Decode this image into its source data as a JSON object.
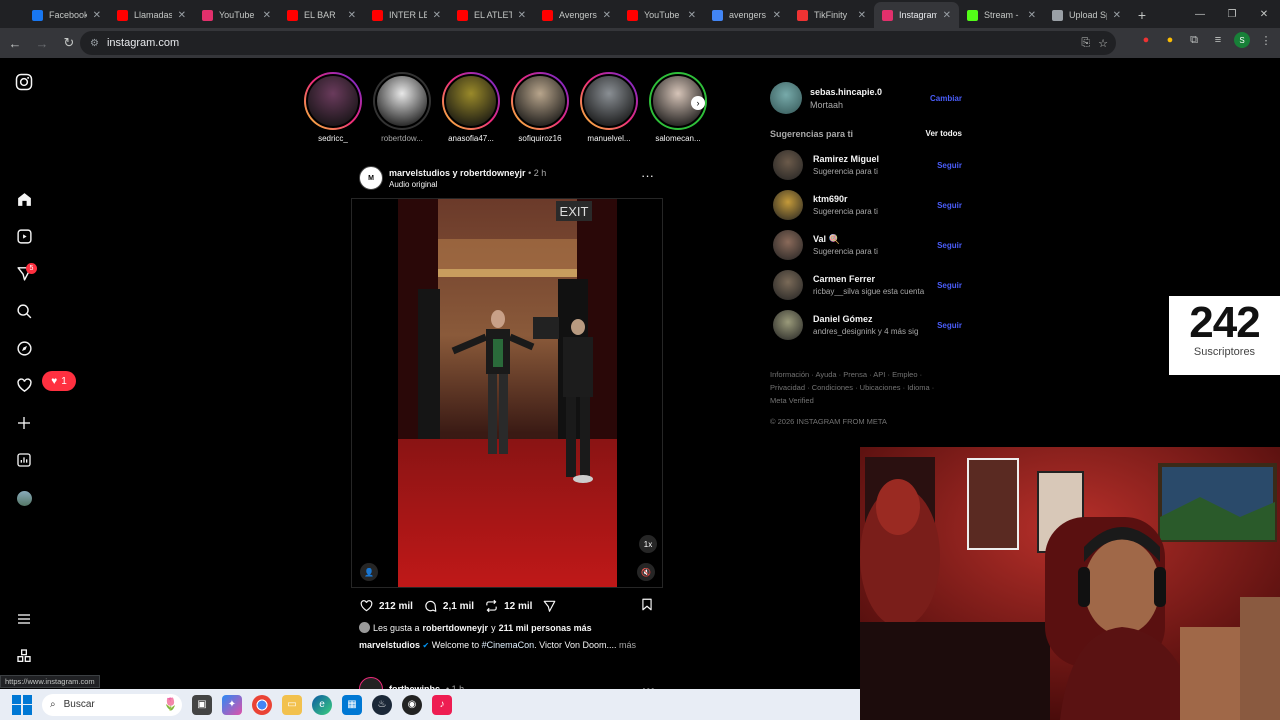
{
  "browser": {
    "tabs": [
      {
        "title": "Facebook",
        "favicon": "facebook-icon",
        "color": "#1877f2"
      },
      {
        "title": "Llamadas",
        "favicon": "youtube-icon",
        "color": "#ff0000"
      },
      {
        "title": "YouTube I",
        "favicon": "instagram-icon",
        "color": "#e1306c"
      },
      {
        "title": "EL BAR",
        "favicon": "youtube-icon",
        "color": "#ff0000"
      },
      {
        "title": "INTER LE",
        "favicon": "youtube-icon",
        "color": "#ff0000"
      },
      {
        "title": "EL ATLETI",
        "favicon": "youtube-icon",
        "color": "#ff0000"
      },
      {
        "title": "Avengers",
        "favicon": "youtube-icon",
        "color": "#ff0000"
      },
      {
        "title": "YouTube",
        "favicon": "youtube-icon",
        "color": "#ff0000"
      },
      {
        "title": "avengers",
        "favicon": "google-icon",
        "color": "#4285f4"
      },
      {
        "title": "TikFinity",
        "favicon": "tikfinity-icon",
        "color": "#e33"
      },
      {
        "title": "Instagram",
        "favicon": "instagram-icon",
        "color": "#e1306c",
        "active": true
      },
      {
        "title": "Stream -",
        "favicon": "kick-icon",
        "color": "#53fc18"
      },
      {
        "title": "Upload Sp",
        "favicon": "upload-icon",
        "color": "#9aa0a6"
      }
    ],
    "address": "instagram.com",
    "status_url": "https://www.instagram.com"
  },
  "stories": [
    {
      "name": "sedricc_",
      "seen": false,
      "color": "#6a3b5c"
    },
    {
      "name": "robertdow...",
      "seen": true,
      "color": "#e8e8e8"
    },
    {
      "name": "anasofia47...",
      "seen": false,
      "color": "#9a8a2a"
    },
    {
      "name": "sofiquiroz16",
      "seen": false,
      "color": "#b8a58c"
    },
    {
      "name": "manuelvel...",
      "seen": false,
      "color": "#8a8f94"
    },
    {
      "name": "salomecan...",
      "seen": false,
      "close": true,
      "color": "#d6c4b8"
    }
  ],
  "post": {
    "authors": "marvelstudios y robertdowneyjr",
    "time": "• 2 h",
    "audio": "Audio original",
    "exit_sign": "EXIT",
    "likes": "212 mil",
    "comments": "2,1 mil",
    "reposts": "12 mil",
    "liked_by_prefix": "Les gusta a ",
    "liked_by_user": "robertdowneyjr",
    "liked_by_mid": " y ",
    "liked_by_count": "211 mil personas más",
    "caption_user": "marvelstudios",
    "caption_text": " Welcome to ",
    "caption_tag": "#CinemaCon",
    "caption_rest": ". Victor Von Doom....",
    "caption_more": " más",
    "speed": "1x"
  },
  "next_post": {
    "author": "forthewinbc",
    "time": "• 1 h"
  },
  "sidebar": {
    "messages_badge": "5",
    "notifications_count": "1"
  },
  "account": {
    "username": "sebas.hincapie.0",
    "name": "Mortaah",
    "switch": "Cambiar"
  },
  "suggestions": {
    "title": "Sugerencias para ti",
    "see_all": "Ver todos",
    "follow": "Seguir",
    "items": [
      {
        "name": "Ramirez Miguel",
        "sub": "Sugerencia para ti",
        "color": "#6b5a4a"
      },
      {
        "name": "ktm690r",
        "sub": "Sugerencia para ti",
        "color": "#c49a3a"
      },
      {
        "name": "Val 🍭",
        "sub": "Sugerencia para ti",
        "color": "#8a6a5a"
      },
      {
        "name": "Carmen Ferrer",
        "sub": "ricbay__silva sigue esta cuenta",
        "color": "#7a6a58"
      },
      {
        "name": "Daniel Gómez",
        "sub": "andres_designink y 4 más sig",
        "color": "#9a9a7a"
      }
    ]
  },
  "footer": {
    "links": [
      "Información",
      "Ayuda",
      "Prensa",
      "API",
      "Empleo",
      "Privacidad",
      "Condiciones",
      "Ubicaciones",
      "Idioma",
      "Meta Verified"
    ],
    "copyright": "© 2026 INSTAGRAM FROM META"
  },
  "subscriber_widget": {
    "count": "242",
    "label": "Suscriptores"
  },
  "taskbar": {
    "search_placeholder": "Buscar"
  }
}
